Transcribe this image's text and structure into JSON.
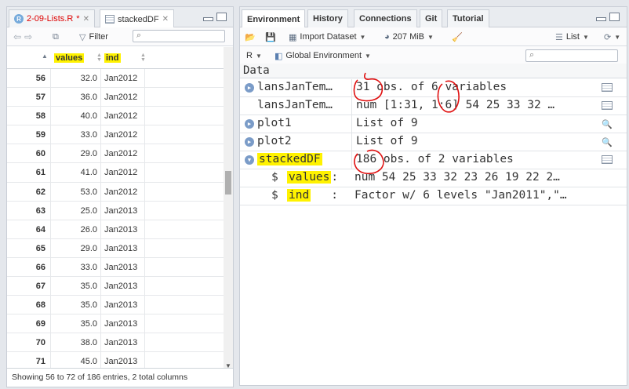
{
  "left": {
    "tabs": [
      {
        "label": "2-09-Lists.R",
        "modified_mark": "*",
        "active": false
      },
      {
        "label": "stackedDF",
        "active": true
      }
    ],
    "toolbar": {
      "filter_label": "Filter",
      "search_placeholder": ""
    },
    "columns": [
      "values",
      "ind"
    ],
    "rows": [
      {
        "idx": "56",
        "values": "32.0",
        "ind": "Jan2012"
      },
      {
        "idx": "57",
        "values": "36.0",
        "ind": "Jan2012"
      },
      {
        "idx": "58",
        "values": "40.0",
        "ind": "Jan2012"
      },
      {
        "idx": "59",
        "values": "33.0",
        "ind": "Jan2012"
      },
      {
        "idx": "60",
        "values": "29.0",
        "ind": "Jan2012"
      },
      {
        "idx": "61",
        "values": "41.0",
        "ind": "Jan2012"
      },
      {
        "idx": "62",
        "values": "53.0",
        "ind": "Jan2012"
      },
      {
        "idx": "63",
        "values": "25.0",
        "ind": "Jan2013"
      },
      {
        "idx": "64",
        "values": "26.0",
        "ind": "Jan2013"
      },
      {
        "idx": "65",
        "values": "29.0",
        "ind": "Jan2013"
      },
      {
        "idx": "66",
        "values": "33.0",
        "ind": "Jan2013"
      },
      {
        "idx": "67",
        "values": "35.0",
        "ind": "Jan2013"
      },
      {
        "idx": "68",
        "values": "35.0",
        "ind": "Jan2013"
      },
      {
        "idx": "69",
        "values": "35.0",
        "ind": "Jan2013"
      },
      {
        "idx": "70",
        "values": "38.0",
        "ind": "Jan2013"
      },
      {
        "idx": "71",
        "values": "45.0",
        "ind": "Jan2013"
      }
    ],
    "status": "Showing 56 to 72 of 186 entries, 2 total columns"
  },
  "right": {
    "tabs": [
      "Environment",
      "History",
      "Connections",
      "Git",
      "Tutorial"
    ],
    "toolbar": {
      "import_label": "Import Dataset",
      "memory": "207 MiB",
      "view_label": "List",
      "lang": "R",
      "scope": "Global Environment"
    },
    "section": "Data",
    "rows": [
      {
        "name": "lansJanTem…",
        "value": "31 obs. of 6 variables",
        "expander": true,
        "tool": "table"
      },
      {
        "name": "lansJanTem…",
        "value": "num [1:31, 1:6] 54 25 33 32 …",
        "expander": false,
        "tool": "table"
      },
      {
        "name": "plot1",
        "value": "List of  9",
        "expander": true,
        "tool": "search"
      },
      {
        "name": "plot2",
        "value": "List of  9",
        "expander": true,
        "tool": "search"
      },
      {
        "name": "stackedDF",
        "value": "186 obs. of 2 variables",
        "expander": true,
        "expanded": true,
        "tool": "table"
      }
    ],
    "sub_rows": [
      {
        "dollar": "$",
        "name": "values",
        "sep": ":",
        "value": "num  54 25 33 32 23 26 19 22 2…"
      },
      {
        "dollar": "$",
        "name": "ind",
        "sep": ":",
        "value": "Factor w/ 6 levels \"Jan2011\",\"…"
      }
    ]
  }
}
